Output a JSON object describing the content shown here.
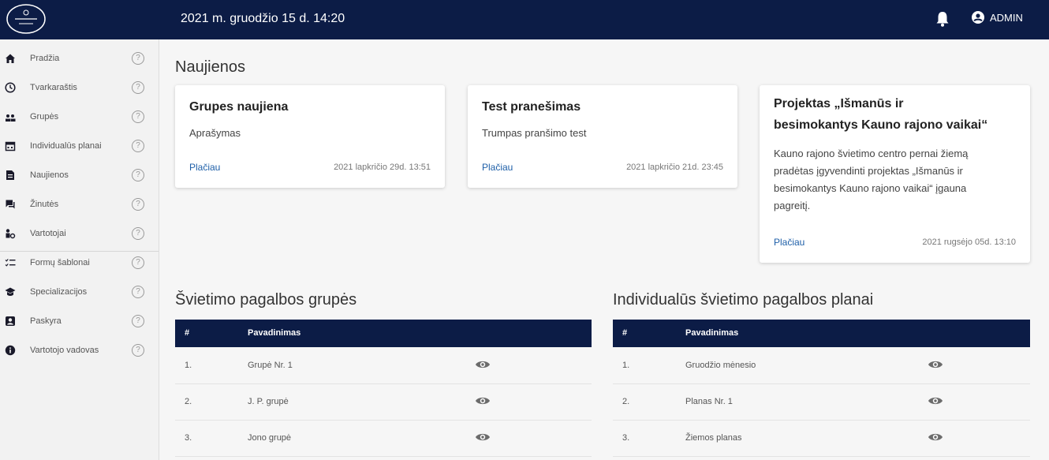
{
  "header": {
    "datetime": "2021 m. gruodžio 15 d.   14:20",
    "user_label": "ADMIN",
    "bg_color": "#0c1c46"
  },
  "sidebar": {
    "items": [
      {
        "label": "Pradžia",
        "icon": "home-icon"
      },
      {
        "label": "Tvarkaraštis",
        "icon": "clock-icon"
      },
      {
        "label": "Grupės",
        "icon": "group-icon"
      },
      {
        "label": "Individualūs planai",
        "icon": "calendar-icon"
      },
      {
        "label": "Naujienos",
        "icon": "news-icon"
      },
      {
        "label": "Žinutės",
        "icon": "messages-icon"
      },
      {
        "label": "Vartotojai",
        "icon": "users-icon"
      },
      {
        "label": "Formų šablonai",
        "icon": "checklist-icon"
      },
      {
        "label": "Specializacijos",
        "icon": "school-icon"
      },
      {
        "label": "Paskyra",
        "icon": "account-icon"
      },
      {
        "label": "Vartotojo vadovas",
        "icon": "info-icon"
      }
    ],
    "help_symbol": "?"
  },
  "news": {
    "title": "Naujienos",
    "cards": [
      {
        "title": "Grupes naujiena",
        "text": "Aprašymas",
        "link": "Plačiau",
        "date": "2021 lapkričio 29d. 13:51"
      },
      {
        "title": "Test pranešimas",
        "text": "Trumpas pranšimo test",
        "link": "Plačiau",
        "date": "2021 lapkričio 21d. 23:45"
      },
      {
        "title_line1": "Projektas „Išmanūs ir",
        "title_line2": "besimokantys Kauno rajono vaikai“",
        "text_lines": [
          "Kauno rajono švietimo centro pernai žiemą",
          "pradėtas įgyvendinti projektas „Išmanūs ir",
          "besimokantys Kauno rajono vaikai“ įgauna",
          "pagreitį."
        ],
        "link": "Plačiau",
        "date": "2021 rugsėjo 05d. 13:10"
      }
    ]
  },
  "groups": {
    "title": "Švietimo pagalbos grupės",
    "col_num": "#",
    "col_name": "Pavadinimas",
    "rows": [
      {
        "num": "1.",
        "name": "Grupė Nr. 1"
      },
      {
        "num": "2.",
        "name": "J. P. grupė"
      },
      {
        "num": "3.",
        "name": "Jono grupė"
      }
    ]
  },
  "plans": {
    "title": "Individualūs švietimo pagalbos planai",
    "col_num": "#",
    "col_name": "Pavadinimas",
    "rows": [
      {
        "num": "1.",
        "name": "Gruodžio mėnesio"
      },
      {
        "num": "2.",
        "name": "Planas Nr. 1"
      },
      {
        "num": "3.",
        "name": "Žiemos planas"
      }
    ]
  }
}
